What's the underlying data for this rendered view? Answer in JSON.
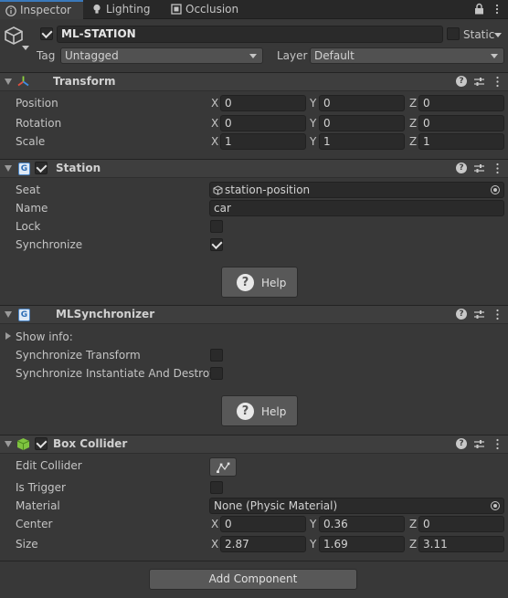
{
  "tabs": [
    {
      "label": "Inspector",
      "icon": "info-icon",
      "active": true
    },
    {
      "label": "Lighting",
      "icon": "lightbulb-icon",
      "active": false
    },
    {
      "label": "Occlusion",
      "icon": "occlusion-icon",
      "active": false
    }
  ],
  "object": {
    "name": "ML-STATION",
    "static_label": "Static",
    "tag_label": "Tag",
    "tag_value": "Untagged",
    "layer_label": "Layer",
    "layer_value": "Default"
  },
  "transform": {
    "title": "Transform",
    "rows": [
      {
        "label": "Position",
        "x": "0",
        "y": "0",
        "z": "0"
      },
      {
        "label": "Rotation",
        "x": "0",
        "y": "0",
        "z": "0"
      },
      {
        "label": "Scale",
        "x": "1",
        "y": "1",
        "z": "1"
      }
    ],
    "axis_labels": {
      "x": "X",
      "y": "Y",
      "z": "Z"
    }
  },
  "station": {
    "title": "Station",
    "enabled": true,
    "seat_label": "Seat",
    "seat_value": "station-position",
    "name_label": "Name",
    "name_value": "car",
    "lock_label": "Lock",
    "lock_checked": false,
    "sync_label": "Synchronize",
    "sync_checked": true,
    "help_label": "Help"
  },
  "mlsync": {
    "title": "MLSynchronizer",
    "show_info": "Show info:",
    "sync_transform_label": "Synchronize Transform",
    "sync_transform_checked": false,
    "sync_instantiate_label": "Synchronize Instantiate And Destroy",
    "sync_instantiate_checked": false,
    "help_label": "Help"
  },
  "box_collider": {
    "title": "Box Collider",
    "enabled": true,
    "edit_collider_label": "Edit Collider",
    "is_trigger_label": "Is Trigger",
    "is_trigger_checked": false,
    "material_label": "Material",
    "material_value": "None (Physic Material)",
    "center_label": "Center",
    "center": {
      "x": "0",
      "y": "0.36",
      "z": "0"
    },
    "size_label": "Size",
    "size": {
      "x": "2.87",
      "y": "1.69",
      "z": "3.11"
    }
  },
  "add_component_label": "Add Component",
  "colors": {
    "background": "#383838",
    "field": "#2a2a2a",
    "accent": "#3a79bb",
    "header": "#3e3e3e"
  }
}
